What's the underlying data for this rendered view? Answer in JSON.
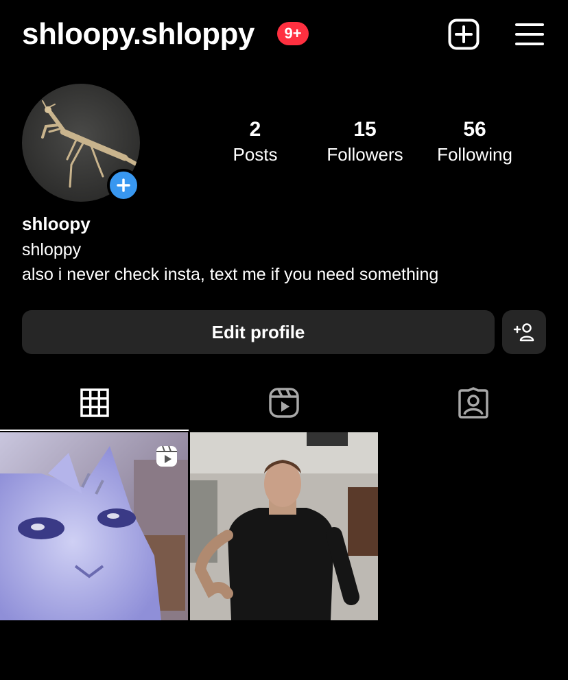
{
  "header": {
    "username": "shloopy.shloppy",
    "notification_badge": "9+",
    "icons": [
      "add-post-icon",
      "menu-icon"
    ]
  },
  "profile": {
    "avatar_icon": "praying-mantis-photo",
    "stats": [
      {
        "value": "2",
        "label": "Posts"
      },
      {
        "value": "15",
        "label": "Followers"
      },
      {
        "value": "56",
        "label": "Following"
      }
    ],
    "name": "shloopy",
    "bio_lines": [
      "shloppy",
      "also i never check insta, text me if you need something"
    ]
  },
  "actions": {
    "edit_profile_label": "Edit profile",
    "suggest_icon": "add-person-icon"
  },
  "tabs": [
    "grid-icon",
    "reels-icon",
    "tagged-icon"
  ],
  "active_tab": 0,
  "posts": [
    {
      "thumbnail": "cat-selfie-video",
      "is_reel": true
    },
    {
      "thumbnail": "man-black-shirt-video",
      "is_reel": false
    }
  ],
  "colors": {
    "background": "#000000",
    "badge": "#ff3040",
    "accent_blue": "#3897f0",
    "button_bg": "#262626"
  }
}
